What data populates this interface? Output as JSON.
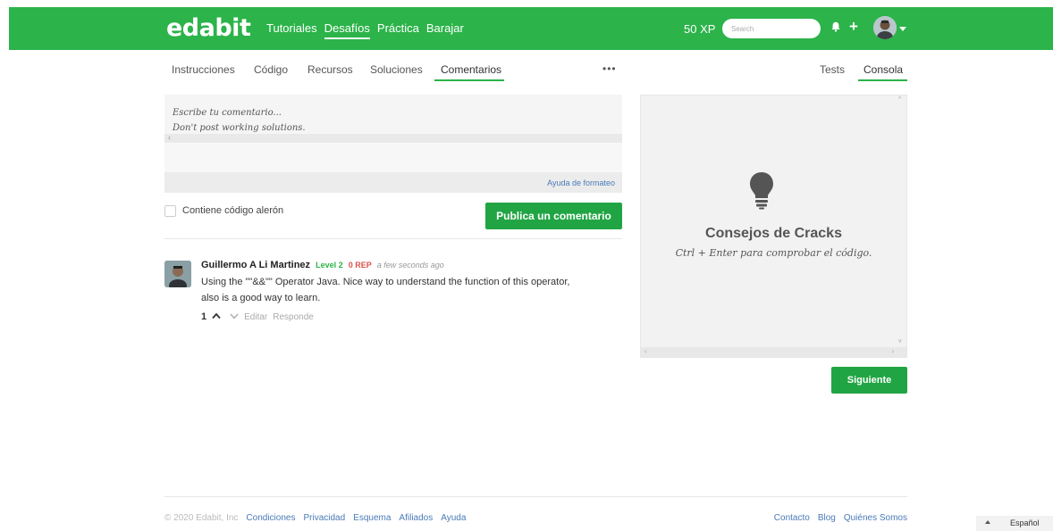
{
  "header": {
    "logo": "edabit",
    "nav": [
      "Tutoriales",
      "Desafíos",
      "Práctica",
      "Barajar"
    ],
    "active_nav": "Desafíos",
    "xp": "50 XP",
    "search_placeholder": "Search",
    "brand_color": "#2cb34a"
  },
  "tabs_left": [
    "Instrucciones",
    "Código",
    "Recursos",
    "Soluciones",
    "Comentarios"
  ],
  "tabs_left_active": "Comentarios",
  "tabs_more": "•••",
  "tabs_right": [
    "Tests",
    "Consola"
  ],
  "tabs_right_active": "Consola",
  "editor": {
    "placeholder_line1": "Escribe tu comentario...",
    "placeholder_line2": "Don't post working solutions.",
    "format_help": "Ayuda de formateo"
  },
  "checkbox_label": "Contiene código alerón",
  "post_button": "Publica un comentario",
  "comment": {
    "author": "Guillermo A Li Martinez",
    "level": "Level 2",
    "rep": "0 REP",
    "time": "a few seconds ago",
    "body": "Using the \"\"&&\"\" Operator Java. Nice way to understand the function of this operator, also is a good way to learn.",
    "votes": "1",
    "edit": "Editar",
    "reply": "Responde"
  },
  "console": {
    "icon": "lightbulb-icon",
    "title": "Consejos de Cracks",
    "subtitle": "Ctrl + Enter para comprobar el código."
  },
  "next_button": "Siguiente",
  "footer": {
    "copyright": "© 2020 Edabit, Inc",
    "left_links": [
      "Condiciones",
      "Privacidad",
      "Esquema",
      "Afiliados",
      "Ayuda"
    ],
    "right_links": [
      "Contacto",
      "Blog",
      "Quiénes Somos"
    ],
    "language": "Español"
  }
}
